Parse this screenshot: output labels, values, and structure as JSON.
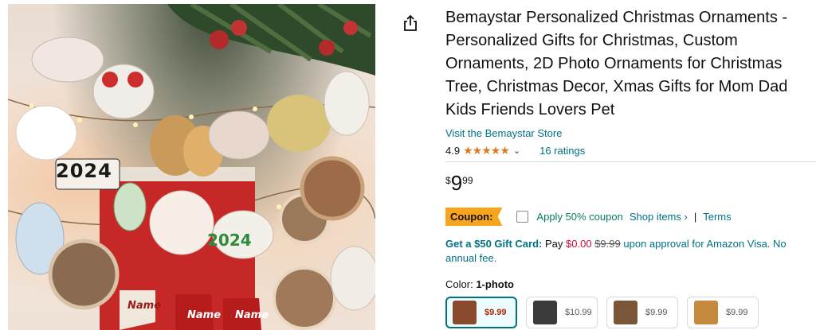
{
  "product": {
    "title": "Bemaystar Personalized Christmas Ornaments - Personalized Gifts for Christmas, Custom Ornaments, 2D Photo Ornaments for Christmas Tree, Christmas Decor, Xmas Gifts for Mom Dad Kids Friends Lovers Pet",
    "store_link": "Visit the Bemaystar Store",
    "rating_value": "4.9",
    "ratings_count": "16 ratings",
    "star_icons": [
      "star-full",
      "star-full",
      "star-full",
      "star-full",
      "star-full"
    ],
    "price": {
      "symbol": "$",
      "whole": "9",
      "fraction": "99"
    }
  },
  "image": {
    "labels": {
      "year_a": "2024",
      "year_b": "2024",
      "name_a": "Name",
      "name_b": "Name",
      "name_c": "Name"
    }
  },
  "coupon": {
    "badge": "Coupon:",
    "text": "Apply 50% coupon",
    "shop_items": "Shop items ›",
    "separator": "|",
    "terms": "Terms"
  },
  "gift_card": {
    "lead": "Get a $50 Gift Card:",
    "pay_prefix": "Pay",
    "pay_amount": "$0.00",
    "strike_price": "$9.99",
    "suffix": "upon approval for Amazon Visa. No annual fee."
  },
  "color": {
    "label": "Color:",
    "selected": "1-photo"
  },
  "swatches": [
    {
      "price": "$9.99",
      "selected": true,
      "thumb_color": "#8a4a2e"
    },
    {
      "price": "$10.99",
      "selected": false,
      "thumb_color": "#3b3b3b"
    },
    {
      "price": "$9.99",
      "selected": false,
      "thumb_color": "#7a5638"
    },
    {
      "price": "$9.99",
      "selected": false,
      "thumb_color": "#c58a3e"
    }
  ],
  "colors": {
    "link": "#007185",
    "accent": "#f7a51d",
    "star": "#de7921",
    "deal": "#067d62"
  }
}
